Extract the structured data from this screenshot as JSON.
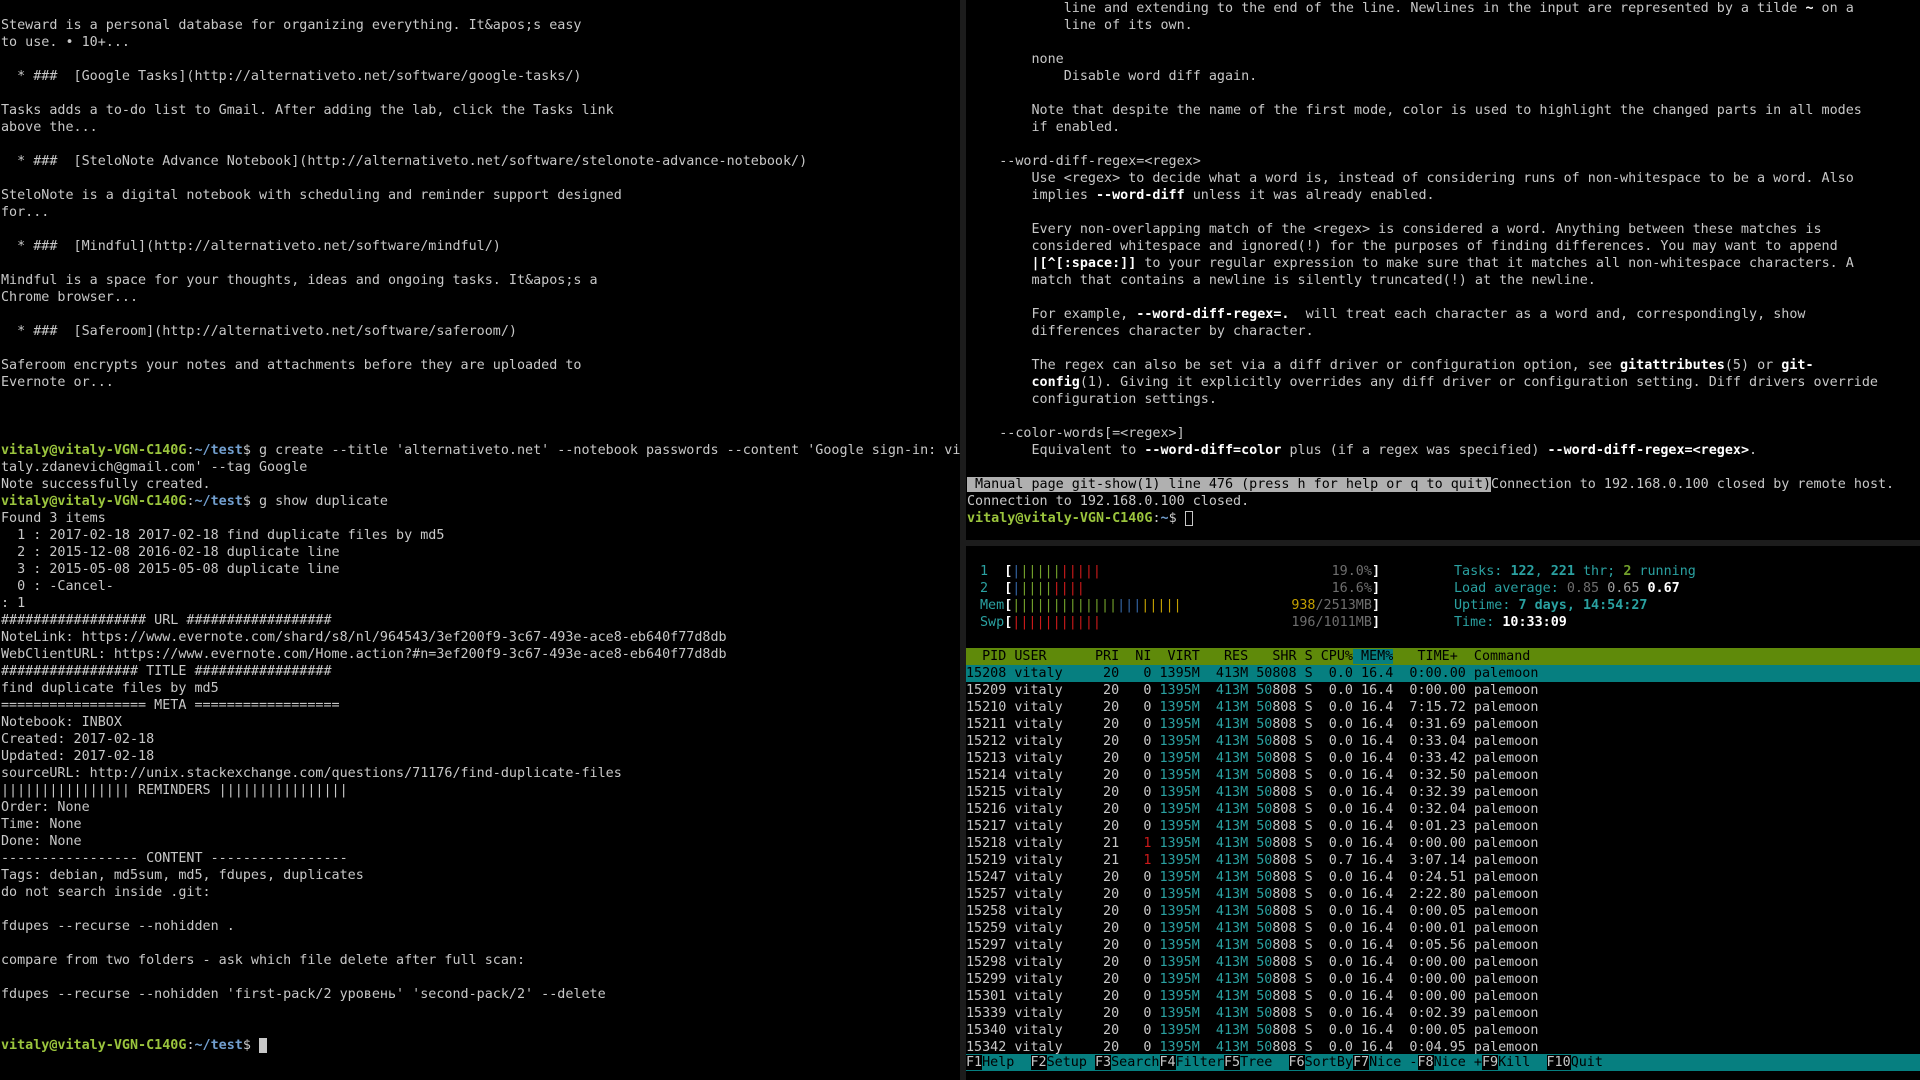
{
  "left_terminal": {
    "prompt_user_host": "vitaly@vitaly-VGN-C140G",
    "prompt_sep": ":",
    "prompt_path": "~/test",
    "prompt_dollar": "$ ",
    "lines": [
      "Steward is a personal database for organizing everything. It&apos;s easy",
      "to use. • 10+...",
      "",
      "  * ###  [Google Tasks](http://alternativeto.net/software/google-tasks/)",
      "",
      "Tasks adds a to-do list to Gmail. After adding the lab, click the Tasks link",
      "above the...",
      "",
      "  * ###  [SteloNote Advance Notebook](http://alternativeto.net/software/stelonote-advance-notebook/)",
      "",
      "SteloNote is a digital notebook with scheduling and reminder support designed",
      "for...",
      "",
      "  * ###  [Mindful](http://alternativeto.net/software/mindful/)",
      "",
      "Mindful is a space for your thoughts, ideas and ongoing tasks. It&apos;s a",
      "Chrome browser...",
      "",
      "  * ###  [Saferoom](http://alternativeto.net/software/saferoom/)",
      "",
      "Saferoom encrypts your notes and attachments before they are uploaded to",
      "Evernote or...",
      "",
      "",
      ""
    ],
    "command1": "g create --title 'alternativeto.net' --notebook passwords --content 'Google sign-in: vi",
    "command1_wrap": "taly.zdanevich@gmail.com' --tag Google",
    "output1": "Note successfully created.",
    "command2": "g show duplicate",
    "output2": [
      "Found 3 items",
      "  1 : 2017-02-18 2017-02-18 find duplicate files by md5",
      "  2 : 2015-12-08 2016-02-18 duplicate line",
      "  3 : 2015-05-08 2015-05-08 duplicate line",
      "  0 : -Cancel-",
      ": 1",
      "################## URL ##################",
      "NoteLink: https://www.evernote.com/shard/s8/nl/964543/3ef200f9-3c67-493e-ace8-eb640f77d8db",
      "WebClientURL: https://www.evernote.com/Home.action?#n=3ef200f9-3c67-493e-ace8-eb640f77d8db",
      "################# TITLE #################",
      "find duplicate files by md5",
      "================== META ==================",
      "Notebook: INBOX",
      "Created: 2017-02-18",
      "Updated: 2017-02-18",
      "sourceURL: http://unix.stackexchange.com/questions/71176/find-duplicate-files",
      "|||||||||||||||| REMINDERS ||||||||||||||||",
      "Order: None",
      "Time: None",
      "Done: None",
      "----------------- CONTENT -----------------",
      "Tags: debian, md5sum, md5, fdupes, duplicates",
      "do not search inside .git:",
      "",
      "fdupes --recurse --nohidden .",
      "",
      "compare from two folders - ask which file delete after full scan:",
      "",
      "fdupes --recurse --nohidden 'first-pack/2 уровень' 'second-pack/2' --delete",
      "",
      ""
    ]
  },
  "man_page": {
    "line1": "            line and extending to the end of the line. Newlines in the input are represented by a tilde ",
    "line1_bold": "~",
    "line1_end": " on a",
    "line2": "            line of its own.",
    "line4": "        none",
    "line5": "            Disable word diff again.",
    "line7": "        Note that despite the name of the first mode, color is used to highlight the changed parts in all modes",
    "line8": "        if enabled.",
    "line10": "    --word-diff-regex=<regex>",
    "line11": "        Use <regex> to decide what a word is, instead of considering runs of non-whitespace to be a word. Also",
    "line12a": "        implies ",
    "line12b": "--word-diff",
    "line12c": " unless it was already enabled.",
    "line14": "        Every non-overlapping match of the <regex> is considered a word. Anything between these matches is",
    "line15": "        considered whitespace and ignored(!) for the purposes of finding differences. You may want to append",
    "line16a": "        ",
    "line16b": "|[^[:space:]]",
    "line16c": " to your regular expression to make sure that it matches all non-whitespace characters. A",
    "line17": "        match that contains a newline is silently truncated(!) at the newline.",
    "line19a": "        For example, ",
    "line19b": "--word-diff-regex=.",
    "line19c": "  will treat each character as a word and, correspondingly, show",
    "line20": "        differences character by character.",
    "line22a": "        The regex can also be set via a diff driver or configuration option, see ",
    "line22b": "gitattributes",
    "line22c": "(5) or ",
    "line22d": "git-",
    "line23a": "        ",
    "line23b": "config",
    "line23c": "(1). Giving it explicitly overrides any diff driver or configuration setting. Diff drivers override",
    "line24": "        configuration settings.",
    "line26": "    --color-words[=<regex>]",
    "line27a": "        Equivalent to ",
    "line27b": "--word-diff=color",
    "line27c": " plus (if a regex was specified) ",
    "line27d": "--word-diff-regex=<regex>",
    "line27e": ".",
    "status_bar": " Manual page git-show(1) line 476 (press h for help or q to quit)",
    "after_status": "Connection to 192.168.0.100 closed by remote host.",
    "closed": "Connection to 192.168.0.100 closed.",
    "prompt_user_host": "vitaly@vitaly-VGN-C140G",
    "prompt_sep": ":",
    "prompt_path": "~",
    "prompt_dollar": "$ "
  },
  "htop": {
    "cpu1": {
      "label": "1",
      "percent": "19.0%",
      "usage": 0.19
    },
    "cpu2": {
      "label": "2",
      "percent": "16.6%",
      "usage": 0.166
    },
    "mem": {
      "label": "Mem",
      "used": "938",
      "total": "/2513MB",
      "usage": 0.373
    },
    "swp": {
      "label": "Swp",
      "value": "196/1011MB",
      "usage": 0.194
    },
    "tasks_label": "Tasks: ",
    "tasks": "122",
    "tasks_sep": ", ",
    "threads": "221",
    "threads_label": " thr; ",
    "running": "2",
    "running_label": " running",
    "load_label": "Load average: ",
    "load1": "0.85",
    "load5": "0.65",
    "load15": "0.67",
    "uptime_label": "Uptime: ",
    "uptime": "7 days, 14:54:27",
    "time_label": "Time: ",
    "time": "10:33:09",
    "columns": [
      "  PID",
      " USER     ",
      " PRI",
      "  NI",
      "  VIRT",
      "   RES",
      "   SHR",
      " S",
      " CPU%",
      " MEM%",
      "   TIME+ ",
      " Command"
    ],
    "sort_column": 9,
    "selected_row": 0,
    "rows": [
      {
        "pid": "15208",
        "user": "vitaly",
        "pri": "20",
        "ni": "0",
        "virt": "1395M",
        "res": "413M",
        "shr": "50808",
        "s": "S",
        "cpu": "0.0",
        "mem": "16.4",
        "time": "0:00.00",
        "cmd": "palemoon"
      },
      {
        "pid": "15209",
        "user": "vitaly",
        "pri": "20",
        "ni": "0",
        "virt": "1395M",
        "res": "413M",
        "shr": "50808",
        "s": "S",
        "cpu": "0.0",
        "mem": "16.4",
        "time": "0:00.00",
        "cmd": "palemoon"
      },
      {
        "pid": "15210",
        "user": "vitaly",
        "pri": "20",
        "ni": "0",
        "virt": "1395M",
        "res": "413M",
        "shr": "50808",
        "s": "S",
        "cpu": "0.0",
        "mem": "16.4",
        "time": "7:15.72",
        "cmd": "palemoon"
      },
      {
        "pid": "15211",
        "user": "vitaly",
        "pri": "20",
        "ni": "0",
        "virt": "1395M",
        "res": "413M",
        "shr": "50808",
        "s": "S",
        "cpu": "0.0",
        "mem": "16.4",
        "time": "0:31.69",
        "cmd": "palemoon"
      },
      {
        "pid": "15212",
        "user": "vitaly",
        "pri": "20",
        "ni": "0",
        "virt": "1395M",
        "res": "413M",
        "shr": "50808",
        "s": "S",
        "cpu": "0.0",
        "mem": "16.4",
        "time": "0:33.04",
        "cmd": "palemoon"
      },
      {
        "pid": "15213",
        "user": "vitaly",
        "pri": "20",
        "ni": "0",
        "virt": "1395M",
        "res": "413M",
        "shr": "50808",
        "s": "S",
        "cpu": "0.0",
        "mem": "16.4",
        "time": "0:33.42",
        "cmd": "palemoon"
      },
      {
        "pid": "15214",
        "user": "vitaly",
        "pri": "20",
        "ni": "0",
        "virt": "1395M",
        "res": "413M",
        "shr": "50808",
        "s": "S",
        "cpu": "0.0",
        "mem": "16.4",
        "time": "0:32.50",
        "cmd": "palemoon"
      },
      {
        "pid": "15215",
        "user": "vitaly",
        "pri": "20",
        "ni": "0",
        "virt": "1395M",
        "res": "413M",
        "shr": "50808",
        "s": "S",
        "cpu": "0.0",
        "mem": "16.4",
        "time": "0:32.39",
        "cmd": "palemoon"
      },
      {
        "pid": "15216",
        "user": "vitaly",
        "pri": "20",
        "ni": "0",
        "virt": "1395M",
        "res": "413M",
        "shr": "50808",
        "s": "S",
        "cpu": "0.0",
        "mem": "16.4",
        "time": "0:32.04",
        "cmd": "palemoon"
      },
      {
        "pid": "15217",
        "user": "vitaly",
        "pri": "20",
        "ni": "0",
        "virt": "1395M",
        "res": "413M",
        "shr": "50808",
        "s": "S",
        "cpu": "0.0",
        "mem": "16.4",
        "time": "0:01.23",
        "cmd": "palemoon"
      },
      {
        "pid": "15218",
        "user": "vitaly",
        "pri": "21",
        "ni": "1",
        "virt": "1395M",
        "res": "413M",
        "shr": "50808",
        "s": "S",
        "cpu": "0.0",
        "mem": "16.4",
        "time": "0:00.00",
        "cmd": "palemoon"
      },
      {
        "pid": "15219",
        "user": "vitaly",
        "pri": "21",
        "ni": "1",
        "virt": "1395M",
        "res": "413M",
        "shr": "50808",
        "s": "S",
        "cpu": "0.7",
        "mem": "16.4",
        "time": "3:07.14",
        "cmd": "palemoon"
      },
      {
        "pid": "15247",
        "user": "vitaly",
        "pri": "20",
        "ni": "0",
        "virt": "1395M",
        "res": "413M",
        "shr": "50808",
        "s": "S",
        "cpu": "0.0",
        "mem": "16.4",
        "time": "0:24.51",
        "cmd": "palemoon"
      },
      {
        "pid": "15257",
        "user": "vitaly",
        "pri": "20",
        "ni": "0",
        "virt": "1395M",
        "res": "413M",
        "shr": "50808",
        "s": "S",
        "cpu": "0.0",
        "mem": "16.4",
        "time": "2:22.80",
        "cmd": "palemoon"
      },
      {
        "pid": "15258",
        "user": "vitaly",
        "pri": "20",
        "ni": "0",
        "virt": "1395M",
        "res": "413M",
        "shr": "50808",
        "s": "S",
        "cpu": "0.0",
        "mem": "16.4",
        "time": "0:00.05",
        "cmd": "palemoon"
      },
      {
        "pid": "15259",
        "user": "vitaly",
        "pri": "20",
        "ni": "0",
        "virt": "1395M",
        "res": "413M",
        "shr": "50808",
        "s": "S",
        "cpu": "0.0",
        "mem": "16.4",
        "time": "0:00.01",
        "cmd": "palemoon"
      },
      {
        "pid": "15297",
        "user": "vitaly",
        "pri": "20",
        "ni": "0",
        "virt": "1395M",
        "res": "413M",
        "shr": "50808",
        "s": "S",
        "cpu": "0.0",
        "mem": "16.4",
        "time": "0:05.56",
        "cmd": "palemoon"
      },
      {
        "pid": "15298",
        "user": "vitaly",
        "pri": "20",
        "ni": "0",
        "virt": "1395M",
        "res": "413M",
        "shr": "50808",
        "s": "S",
        "cpu": "0.0",
        "mem": "16.4",
        "time": "0:00.00",
        "cmd": "palemoon"
      },
      {
        "pid": "15299",
        "user": "vitaly",
        "pri": "20",
        "ni": "0",
        "virt": "1395M",
        "res": "413M",
        "shr": "50808",
        "s": "S",
        "cpu": "0.0",
        "mem": "16.4",
        "time": "0:00.00",
        "cmd": "palemoon"
      },
      {
        "pid": "15301",
        "user": "vitaly",
        "pri": "20",
        "ni": "0",
        "virt": "1395M",
        "res": "413M",
        "shr": "50808",
        "s": "S",
        "cpu": "0.0",
        "mem": "16.4",
        "time": "0:00.00",
        "cmd": "palemoon"
      },
      {
        "pid": "15339",
        "user": "vitaly",
        "pri": "20",
        "ni": "0",
        "virt": "1395M",
        "res": "413M",
        "shr": "50808",
        "s": "S",
        "cpu": "0.0",
        "mem": "16.4",
        "time": "0:02.39",
        "cmd": "palemoon"
      },
      {
        "pid": "15340",
        "user": "vitaly",
        "pri": "20",
        "ni": "0",
        "virt": "1395M",
        "res": "413M",
        "shr": "50808",
        "s": "S",
        "cpu": "0.0",
        "mem": "16.4",
        "time": "0:00.05",
        "cmd": "palemoon"
      },
      {
        "pid": "15342",
        "user": "vitaly",
        "pri": "20",
        "ni": "0",
        "virt": "1395M",
        "res": "413M",
        "shr": "50808",
        "s": "S",
        "cpu": "0.0",
        "mem": "16.4",
        "time": "0:04.95",
        "cmd": "palemoon"
      }
    ],
    "function_keys": [
      {
        "key": "F1",
        "label": "Help  "
      },
      {
        "key": "F2",
        "label": "Setup "
      },
      {
        "key": "F3",
        "label": "Search"
      },
      {
        "key": "F4",
        "label": "Filter"
      },
      {
        "key": "F5",
        "label": "Tree  "
      },
      {
        "key": "F6",
        "label": "SortBy"
      },
      {
        "key": "F7",
        "label": "Nice -"
      },
      {
        "key": "F8",
        "label": "Nice +"
      },
      {
        "key": "F9",
        "label": "Kill  "
      },
      {
        "key": "F10",
        "label": "Quit"
      }
    ]
  }
}
